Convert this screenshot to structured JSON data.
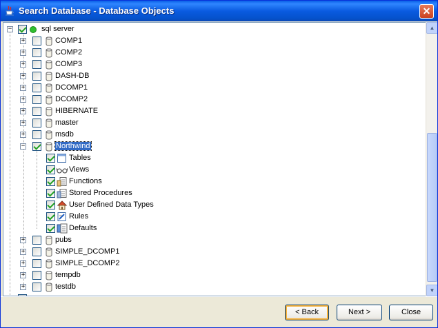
{
  "window": {
    "title": "Search Database - Database Objects",
    "close_glyph": "✕"
  },
  "tree": {
    "root": {
      "label": "sql server",
      "checked": true,
      "expanded": true,
      "status_color": "#2fbf2f"
    },
    "databases": [
      {
        "label": "COMP1",
        "checked": false,
        "expanded": false
      },
      {
        "label": "COMP2",
        "checked": false,
        "expanded": false
      },
      {
        "label": "COMP3",
        "checked": false,
        "expanded": false
      },
      {
        "label": "DASH-DB",
        "checked": false,
        "expanded": false
      },
      {
        "label": "DCOMP1",
        "checked": false,
        "expanded": false
      },
      {
        "label": "DCOMP2",
        "checked": false,
        "expanded": false
      },
      {
        "label": "HIBERNATE",
        "checked": false,
        "expanded": false
      },
      {
        "label": "master",
        "checked": false,
        "expanded": false
      },
      {
        "label": "msdb",
        "checked": false,
        "expanded": false
      },
      {
        "label": "Northwind",
        "checked": true,
        "expanded": true,
        "selected": true
      },
      {
        "label": "pubs",
        "checked": false,
        "expanded": false
      },
      {
        "label": "SIMPLE_DCOMP1",
        "checked": false,
        "expanded": false
      },
      {
        "label": "SIMPLE_DCOMP2",
        "checked": false,
        "expanded": false
      },
      {
        "label": "tempdb",
        "checked": false,
        "expanded": false
      },
      {
        "label": "testdb",
        "checked": false,
        "expanded": false
      }
    ],
    "northwind_children": [
      {
        "label": "Tables",
        "icon": "table-icon",
        "checked": true
      },
      {
        "label": "Views",
        "icon": "glasses-icon",
        "checked": true
      },
      {
        "label": "Functions",
        "icon": "function-icon",
        "checked": true
      },
      {
        "label": "Stored Procedures",
        "icon": "stored-procedure-icon",
        "checked": true
      },
      {
        "label": "User Defined Data Types",
        "icon": "house-icon",
        "checked": true
      },
      {
        "label": "Rules",
        "icon": "rule-icon",
        "checked": true
      },
      {
        "label": "Defaults",
        "icon": "defaults-icon",
        "checked": true
      }
    ]
  },
  "buttons": {
    "back": "< Back",
    "next": "Next >",
    "close": "Close"
  },
  "colors": {
    "titlebar": "#0a5be0",
    "selection": "#316ac5",
    "check": "#21a121"
  }
}
